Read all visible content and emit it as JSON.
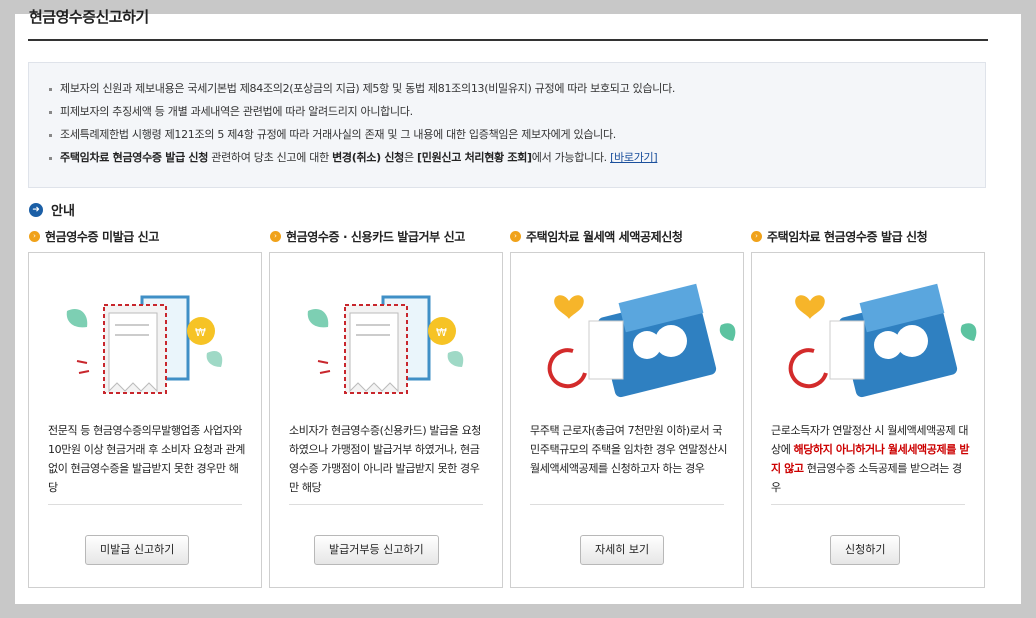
{
  "page_title": "현금영수증신고하기",
  "notice": {
    "line1": "제보자의 신원과 제보내용은 국세기본법 제84조의2(포상금의 지급) 제5항 및 동법 제81조의13(비밀유지) 규정에 따라 보호되고 있습니다.",
    "line2": "피제보자의 추징세액 등 개별 과세내역은 관련법에 따라 알려드리지 아니합니다.",
    "line3": "조세특례제한법 시행령 제121조의 5 제4항 규정에 따라 거래사실의 존재 및 그 내용에 대한 입증책임은 제보자에게 있습니다.",
    "line4_part1": "주택임차료 현금영수증 발급 신청",
    "line4_part2": " 관련하여 당초 신고에 대한 ",
    "line4_part3": "변경(취소) 신청",
    "line4_part4": "은 ",
    "line4_part5": "[민원신고 처리현황 조회]",
    "line4_part6": "에서 가능합니다. ",
    "line4_link": "[바로가기]"
  },
  "guide_label": "안내",
  "cards": [
    {
      "title": "현금영수증 미발급 신고",
      "desc": "전문직 등 현금영수증의무발행업종 사업자와 10만원 이상 현금거래 후 소비자 요청과 관계 없이 현금영수증을 발급받지 못한 경우만 해당",
      "button": "미발급 신고하기"
    },
    {
      "title": "현금영수증 · 신용카드 발급거부 신고",
      "desc": "소비자가 현금영수증(신용카드) 발급을 요청하였으나 가맹점이 발급거부 하였거나, 현금영수증 가맹점이 아니라 발급받지 못한 경우만 해당",
      "button": "발급거부등 신고하기"
    },
    {
      "title": "주택임차료 월세액 세액공제신청",
      "desc": "무주택 근로자(총급여 7천만원 이하)로서 국민주택규모의 주택을 임차한 경우 연말정산시 월세액세액공제를 신청하고자 하는 경우",
      "button": "자세히 보기"
    },
    {
      "title": "주택임차료 현금영수증 발급 신청",
      "desc_part1": "근로소득자가 연말정산 시 월세액세액공제 대상에 ",
      "desc_red": "해당하지 아니하거나 월세세액공제를 받지 않고",
      "desc_part2": " 현금영수증 소득공제를 받으려는 경우",
      "button": "신청하기"
    }
  ],
  "colors": {
    "accent_blue": "#1b5fa6",
    "bullet_orange": "#f0a21a",
    "highlight_red": "#cc0000"
  }
}
